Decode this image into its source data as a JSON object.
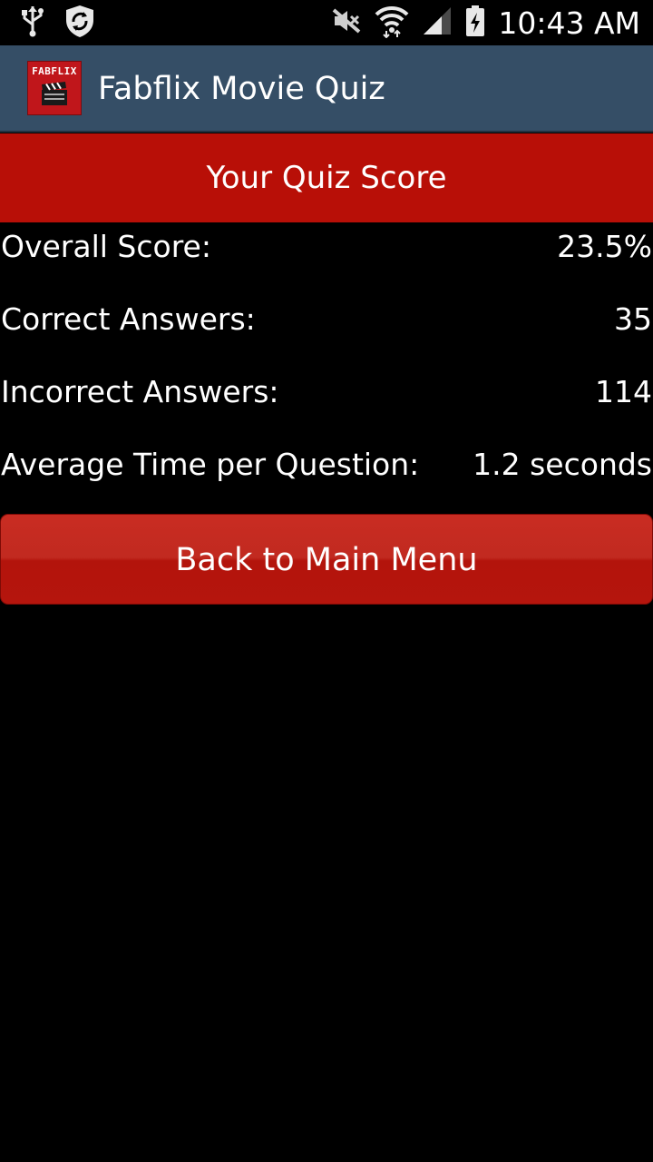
{
  "status_bar": {
    "time": "10:43 AM",
    "icons": [
      "usb-icon",
      "shield-sync-icon",
      "mute-icon",
      "wifi-icon",
      "signal-icon",
      "battery-charging-icon"
    ]
  },
  "action_bar": {
    "logo_text": "FABFLIX",
    "title": "Fabflix Movie Quiz"
  },
  "header": {
    "title": "Your Quiz Score"
  },
  "stats": [
    {
      "label": "Overall Score:",
      "value": "23.5%"
    },
    {
      "label": "Correct Answers:",
      "value": "35"
    },
    {
      "label": "Incorrect Answers:",
      "value": "114"
    },
    {
      "label": "Average Time per Question:",
      "value": "1.2 seconds"
    }
  ],
  "back_button": {
    "label": "Back to Main Menu"
  },
  "colors": {
    "action_bar": "#354e66",
    "header_red": "#b80f07",
    "background": "#000000"
  }
}
